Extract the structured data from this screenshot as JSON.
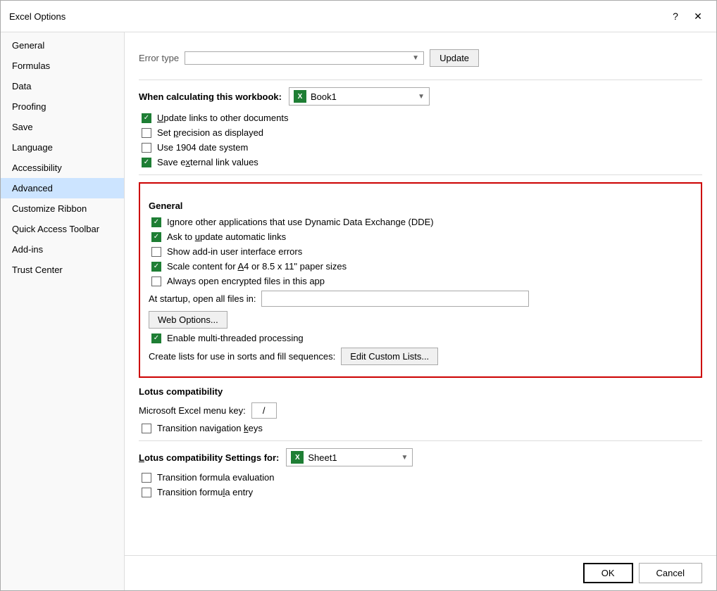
{
  "dialog": {
    "title": "Excel Options",
    "help_btn": "?",
    "close_btn": "✕"
  },
  "sidebar": {
    "items": [
      {
        "id": "general",
        "label": "General",
        "active": false
      },
      {
        "id": "formulas",
        "label": "Formulas",
        "active": false
      },
      {
        "id": "data",
        "label": "Data",
        "active": false
      },
      {
        "id": "proofing",
        "label": "Proofing",
        "active": false
      },
      {
        "id": "save",
        "label": "Save",
        "active": false
      },
      {
        "id": "language",
        "label": "Language",
        "active": false
      },
      {
        "id": "accessibility",
        "label": "Accessibility",
        "active": false
      },
      {
        "id": "advanced",
        "label": "Advanced",
        "active": true
      },
      {
        "id": "customize-ribbon",
        "label": "Customize Ribbon",
        "active": false
      },
      {
        "id": "quick-access-toolbar",
        "label": "Quick Access Toolbar",
        "active": false
      },
      {
        "id": "add-ins",
        "label": "Add-ins",
        "active": false
      },
      {
        "id": "trust-center",
        "label": "Trust Center",
        "active": false
      }
    ]
  },
  "main": {
    "workbook_section": {
      "label": "When calculating this workbook:",
      "dropdown": {
        "icon": "X",
        "value": "Book1",
        "arrow": "▼"
      },
      "options": [
        {
          "id": "update-links",
          "label": "Update links to other documents",
          "checked": true
        },
        {
          "id": "set-precision",
          "label": "Set precision as displayed",
          "checked": false
        },
        {
          "id": "use-1904",
          "label": "Use 1904 date system",
          "checked": false
        },
        {
          "id": "save-external",
          "label": "Save external link values",
          "checked": true
        }
      ]
    },
    "general_section": {
      "title": "General",
      "options": [
        {
          "id": "ignore-dde",
          "label": "Ignore other applications that use Dynamic Data Exchange (DDE)",
          "checked": true
        },
        {
          "id": "ask-update",
          "label": "Ask to update automatic links",
          "checked": true
        },
        {
          "id": "show-addin",
          "label": "Show add-in user interface errors",
          "checked": false
        },
        {
          "id": "scale-a4",
          "label": "Scale content for A4 or 8.5 x 11\" paper sizes",
          "checked": true
        },
        {
          "id": "always-open-encrypted",
          "label": "Always open encrypted files in this app",
          "checked": false
        }
      ],
      "startup_label": "At startup, open all files in:",
      "startup_value": "",
      "web_options_btn": "Web Options...",
      "enable_multithread": {
        "id": "enable-multithread",
        "label": "Enable multi-threaded processing",
        "checked": true
      },
      "create_lists_label": "Create lists for use in sorts and fill sequences:",
      "edit_custom_lists_btn": "Edit Custom Lists..."
    },
    "lotus_section": {
      "title": "Lotus compatibility",
      "menu_key_label": "Microsoft Excel menu key:",
      "menu_key_value": "/",
      "options": [
        {
          "id": "transition-nav",
          "label": "Transition navigation keys",
          "checked": false
        }
      ]
    },
    "lotus_settings_section": {
      "label": "Lotus compatibility Settings for:",
      "dropdown": {
        "icon": "X",
        "value": "Sheet1",
        "arrow": "▼"
      },
      "options": [
        {
          "id": "transition-formula-eval",
          "label": "Transition formula evaluation",
          "checked": false
        },
        {
          "id": "transition-formula-entry",
          "label": "Transition formula entry",
          "checked": false
        }
      ]
    }
  },
  "footer": {
    "ok_label": "OK",
    "cancel_label": "Cancel"
  }
}
